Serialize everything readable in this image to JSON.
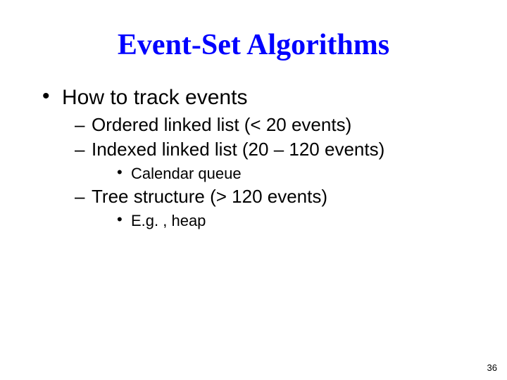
{
  "title": "Event-Set Algorithms",
  "bullets": {
    "l1": "How to track events",
    "l2a": "Ordered linked list (< 20 events)",
    "l2b": "Indexed linked list (20 – 120 events)",
    "l3a": "Calendar queue",
    "l2c": "Tree structure (> 120 events)",
    "l3b": "E.g. , heap"
  },
  "page_number": "36"
}
